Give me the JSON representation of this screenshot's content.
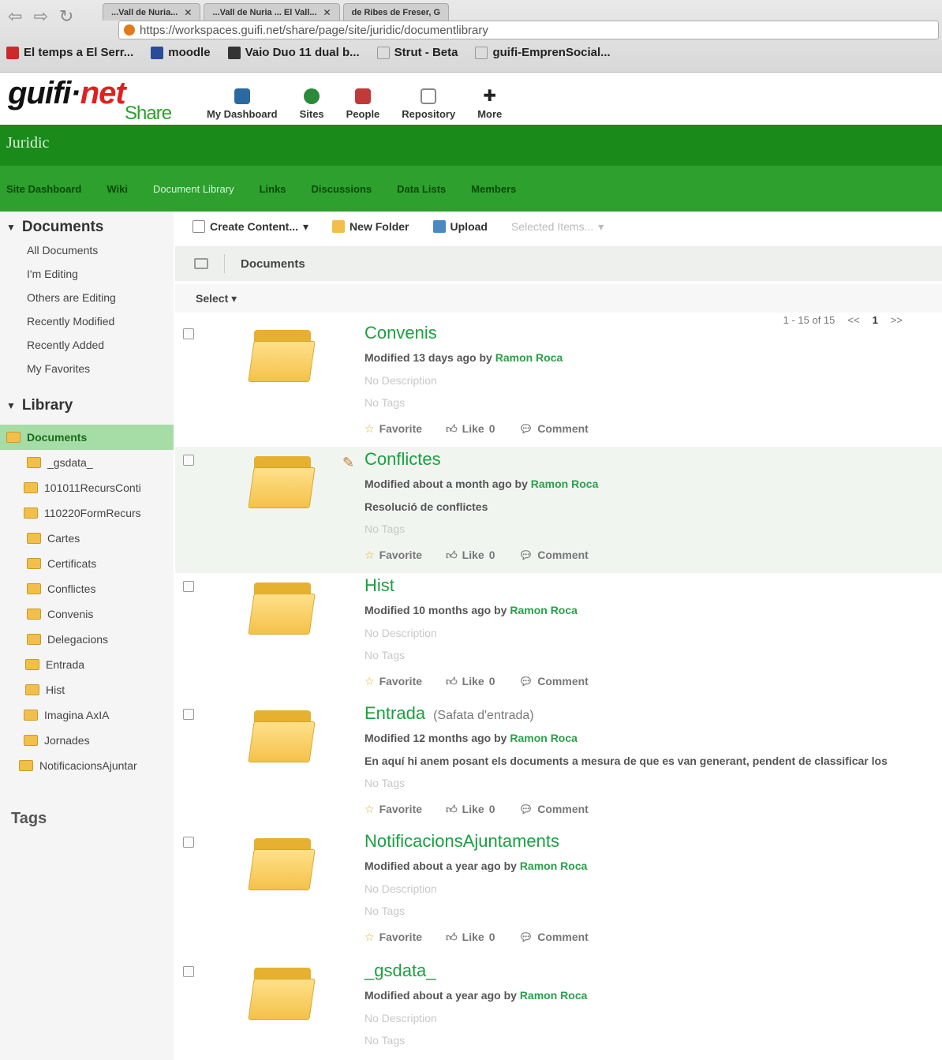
{
  "browser": {
    "tabs": [
      {
        "label": "...Vall de Nuria..."
      },
      {
        "label": "...Vall de Nuria ... El Vall..."
      },
      {
        "label": "de Ribes de Freser, G"
      }
    ],
    "url": "https://workspaces.guifi.net/share/page/site/juridic/documentlibrary",
    "bookmarks": [
      {
        "label": "El temps a El Serr...",
        "color": "#cc2a2a"
      },
      {
        "label": "moodle",
        "color": "#2a4a9a"
      },
      {
        "label": "Vaio Duo 11 dual b...",
        "color": "#333333"
      },
      {
        "label": "Strut - Beta",
        "color": "#999999"
      },
      {
        "label": "guifi-EmprenSocial...",
        "color": "#999999"
      }
    ]
  },
  "header": {
    "logo_main": "guifi",
    "logo_dot": "·",
    "logo_net": "net",
    "logo_share": "Share",
    "nav": [
      {
        "label": "My Dashboard",
        "icon": "dashboard-icon",
        "color": "#2a6aa0"
      },
      {
        "label": "Sites",
        "icon": "globe-icon",
        "color": "#2a8a3a"
      },
      {
        "label": "People",
        "icon": "people-icon",
        "color": "#c03a3a"
      },
      {
        "label": "Repository",
        "icon": "repository-icon",
        "color": "#888888"
      },
      {
        "label": "More",
        "icon": "plus-icon",
        "color": "#222222"
      }
    ]
  },
  "site": {
    "title": "Juridic",
    "nav": [
      {
        "label": "Site Dashboard",
        "active": false
      },
      {
        "label": "Wiki",
        "active": false
      },
      {
        "label": "Document Library",
        "active": true
      },
      {
        "label": "Links",
        "active": false
      },
      {
        "label": "Discussions",
        "active": false
      },
      {
        "label": "Data Lists",
        "active": false
      },
      {
        "label": "Members",
        "active": false
      }
    ]
  },
  "sidebar": {
    "documents_heading": "Documents",
    "document_filters": [
      "All Documents",
      "I'm Editing",
      "Others are Editing",
      "Recently Modified",
      "Recently Added",
      "My Favorites"
    ],
    "library_heading": "Library",
    "tree_root": "Documents",
    "tree_items": [
      "_gsdata_",
      "101011RecursConti",
      "110220FormRecurs",
      "Cartes",
      "Certificats",
      "Conflictes",
      "Convenis",
      "Delegacions",
      "Entrada",
      "Hist",
      "Imagina AxIA",
      "Jornades",
      "NotificacionsAjuntar"
    ],
    "tags_heading": "Tags"
  },
  "toolbar": {
    "create_content": "Create Content...",
    "new_folder": "New Folder",
    "upload": "Upload",
    "selected_items": "Selected Items..."
  },
  "breadcrumb": {
    "label": "Documents"
  },
  "select_label": "Select",
  "pager": {
    "range": "1 - 15 of 15",
    "prev": "<<",
    "page": "1",
    "next": ">>"
  },
  "documents": [
    {
      "title": "Convenis",
      "subtitle": "",
      "modified": "Modified 13 days ago by",
      "user": "Ramon Roca",
      "description": "No Description",
      "desc_present": false,
      "tags": "No Tags"
    },
    {
      "title": "Conflictes",
      "subtitle": "",
      "modified": "Modified about a month ago by",
      "user": "Ramon Roca",
      "description": "Resolució de conflictes",
      "desc_present": true,
      "tags": "No Tags"
    },
    {
      "title": "Hist",
      "subtitle": "",
      "modified": "Modified 10 months ago by",
      "user": "Ramon Roca",
      "description": "No Description",
      "desc_present": false,
      "tags": "No Tags"
    },
    {
      "title": "Entrada",
      "subtitle": "(Safata d'entrada)",
      "modified": "Modified 12 months ago by",
      "user": "Ramon Roca",
      "description": "En aquí hi anem posant els documents a mesura de que es van generant, pendent de classificar los",
      "desc_present": true,
      "tags": "No Tags"
    },
    {
      "title": "NotificacionsAjuntaments",
      "subtitle": "",
      "modified": "Modified about a year ago by",
      "user": "Ramon Roca",
      "description": "No Description",
      "desc_present": false,
      "tags": "No Tags"
    },
    {
      "title": "_gsdata_",
      "subtitle": "",
      "modified": "Modified about a year ago by",
      "user": "Ramon Roca",
      "description": "No Description",
      "desc_present": false,
      "tags": "No Tags"
    }
  ],
  "actions": {
    "favorite": "Favorite",
    "like": "Like",
    "like_count": "0",
    "comment": "Comment"
  }
}
